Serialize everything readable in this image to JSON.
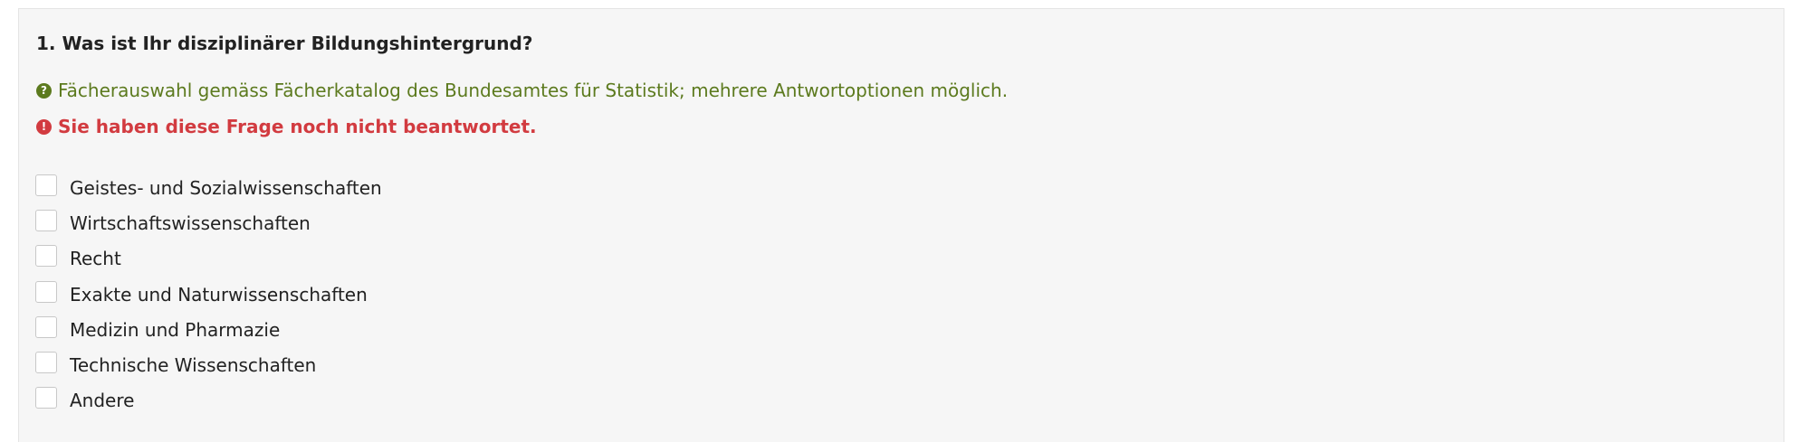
{
  "question": {
    "title": "1. Was ist Ihr disziplinärer Bildungshintergrund?",
    "hint_icon": "question-circle-icon",
    "hint": "Fächerauswahl gemäss Fächerkatalog des Bundesamtes für Statistik; mehrere Antwortoptionen möglich.",
    "error_icon": "exclamation-circle-icon",
    "error": "Sie haben diese Frage noch nicht beantwortet.",
    "options": [
      {
        "label": "Geistes- und Sozialwissenschaften",
        "checked": false
      },
      {
        "label": "Wirtschaftswissenschaften",
        "checked": false
      },
      {
        "label": "Recht",
        "checked": false
      },
      {
        "label": "Exakte und Naturwissenschaften",
        "checked": false
      },
      {
        "label": "Medizin und Pharmazie",
        "checked": false
      },
      {
        "label": "Technische Wissenschaften",
        "checked": false
      },
      {
        "label": "Andere",
        "checked": false
      }
    ]
  },
  "colors": {
    "panel_background": "#f6f6f6",
    "hint": "#5c7a1e",
    "error": "#d23b40",
    "text": "#222222"
  }
}
